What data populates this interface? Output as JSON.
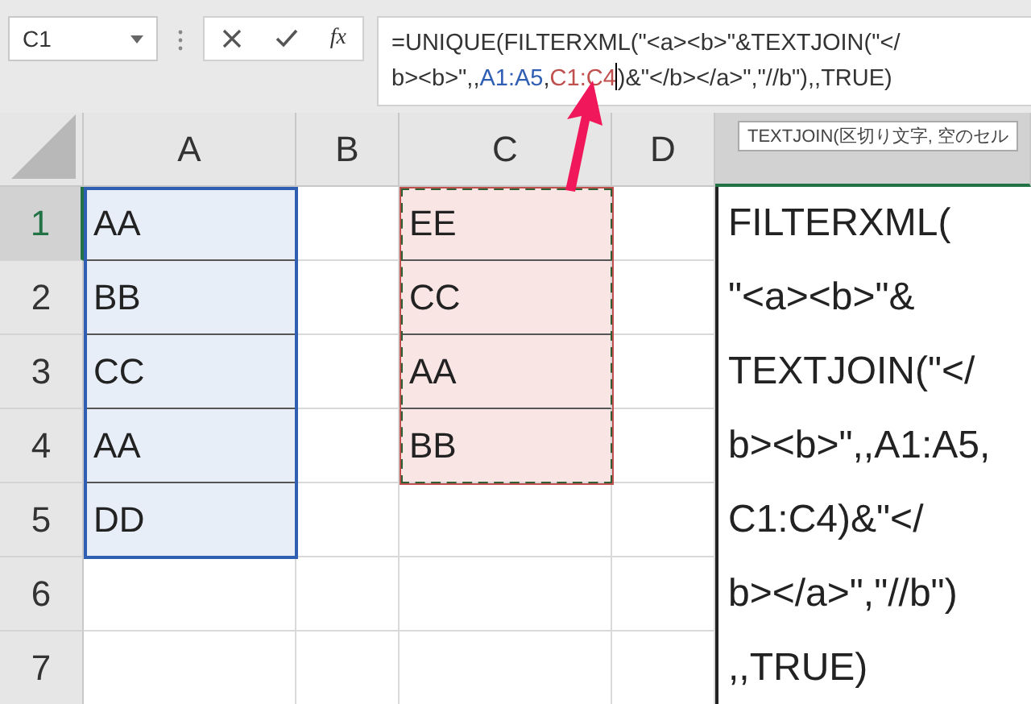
{
  "name_box": {
    "value": "C1"
  },
  "formula_buttons": {
    "function_label": "fx"
  },
  "formula_bar": {
    "lines": [
      [
        {
          "text": "=UNIQUE(FILTERXML(\"<a><b>\"&TEXTJOIN(\"</"
        }
      ],
      [
        {
          "text": "b><b>\",,"
        },
        {
          "text": "A1:A5",
          "color": "#2f5fb3"
        },
        {
          "text": ","
        },
        {
          "text": "C1:C4",
          "color": "#c0504d"
        },
        {
          "text": ")&\"</b></a>\",\"//b\"),,TRUE)"
        }
      ]
    ]
  },
  "tooltip": {
    "text": "TEXTJOIN(区切り文字, 空のセル"
  },
  "rows": [
    {
      "label": "1",
      "selected": true
    },
    {
      "label": "2",
      "selected": false
    },
    {
      "label": "3",
      "selected": false
    },
    {
      "label": "4",
      "selected": false
    },
    {
      "label": "5",
      "selected": false
    },
    {
      "label": "6",
      "selected": false
    },
    {
      "label": "7",
      "selected": false
    }
  ],
  "columns": [
    {
      "label": "A",
      "selected": false,
      "cells": [
        "AA",
        "BB",
        "CC",
        "AA",
        "DD"
      ],
      "range": {
        "color": "#2f5fb3",
        "marquee": false
      }
    },
    {
      "label": "B",
      "selected": false
    },
    {
      "label": "C",
      "selected": false,
      "cells": [
        "EE",
        "CC",
        "AA",
        "BB"
      ],
      "range": {
        "color": "#c0504d",
        "marquee": true
      }
    },
    {
      "label": "D",
      "selected": false
    },
    {
      "selected": true,
      "wrapped_lines": [
        "FILTERXML(",
        "\"<a><b>\"&",
        "TEXTJOIN(\"</",
        "b><b>\",,A1:A5,",
        "C1:C4)&\"</",
        "b></a>\",\"//b\")",
        ",,TRUE)"
      ]
    }
  ]
}
